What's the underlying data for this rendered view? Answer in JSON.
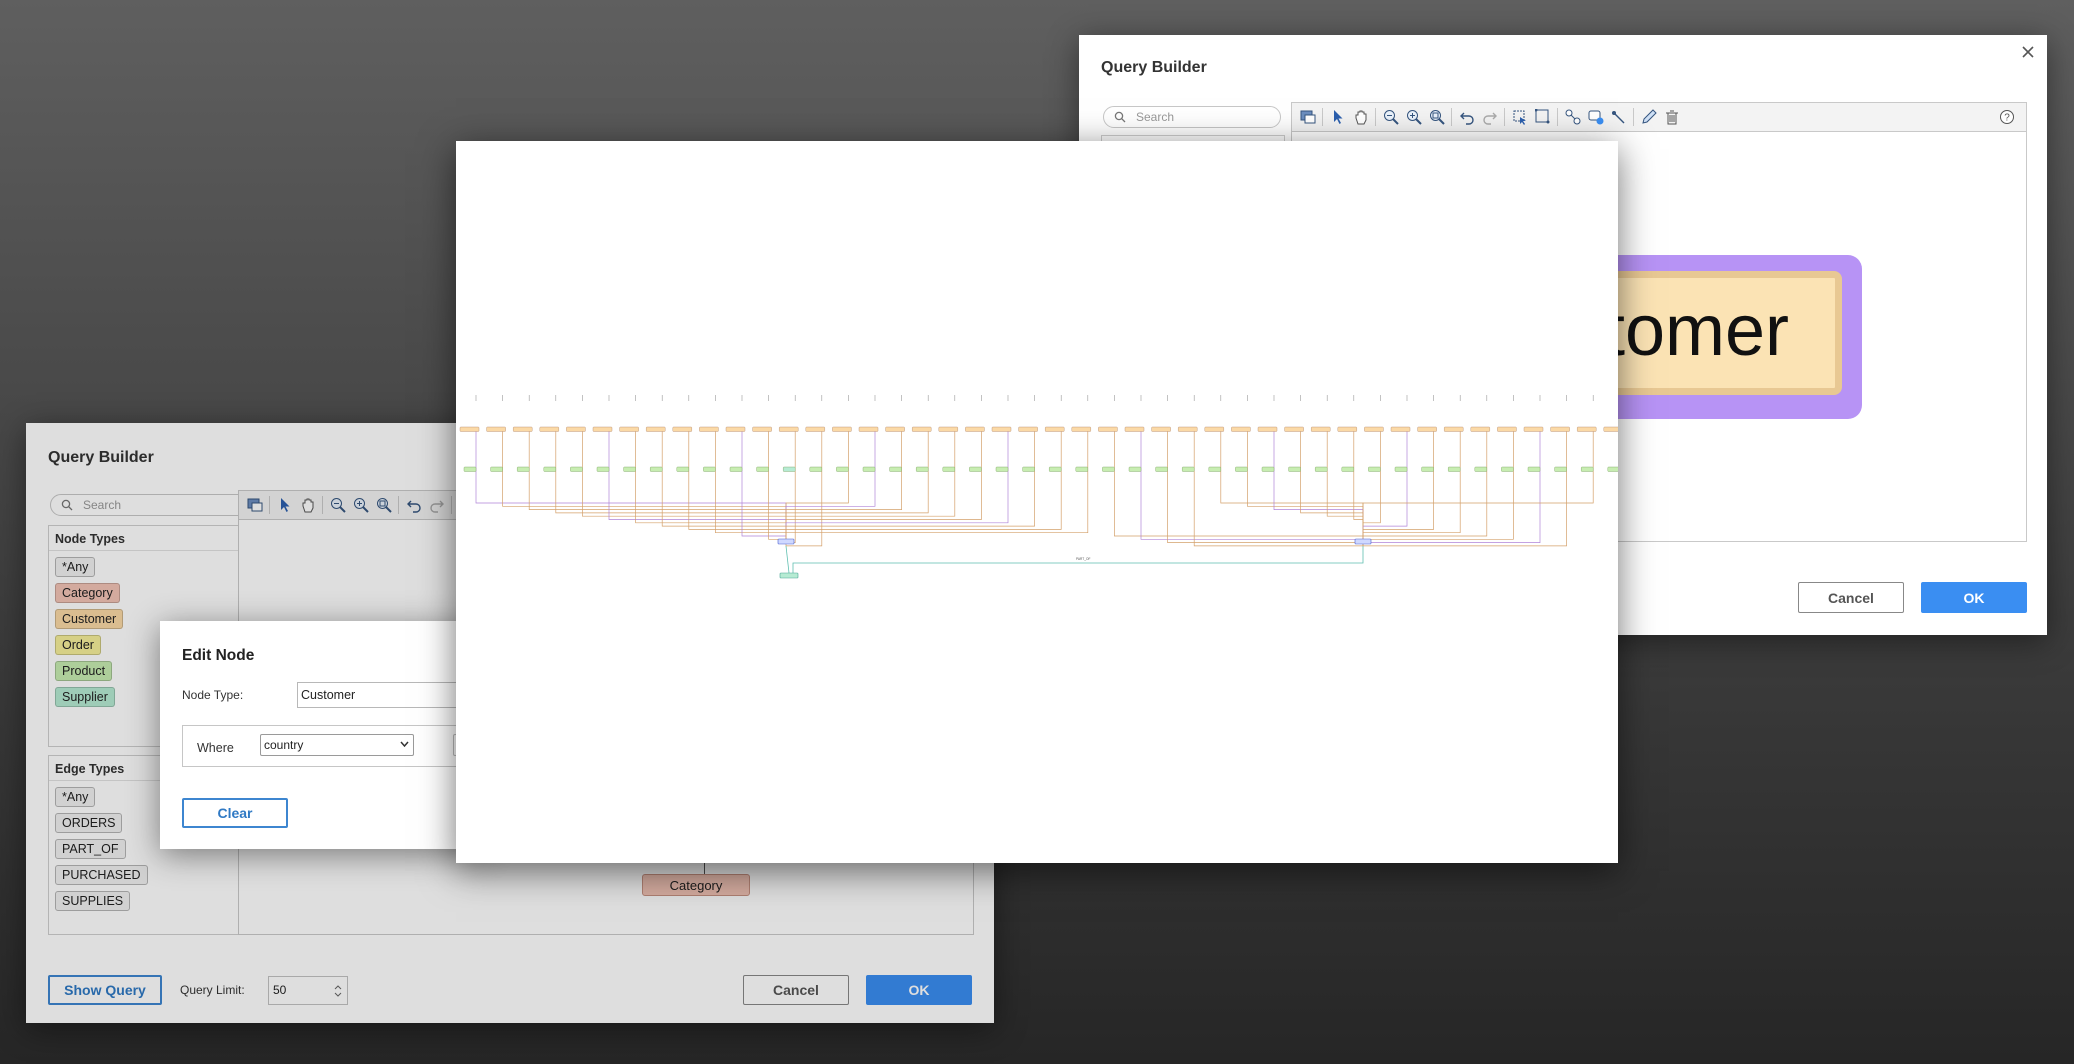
{
  "qb_back": {
    "title": "Query Builder",
    "search_placeholder": "Search",
    "node_label": "Customer",
    "cancel_label": "Cancel",
    "ok_label": "OK"
  },
  "qb_front": {
    "title": "Query Builder",
    "search_placeholder": "Search",
    "node_types_title": "Node Types",
    "node_types": [
      {
        "label": "*Any",
        "color": "#f1f1f1"
      },
      {
        "label": "Category",
        "color": "#f3c4b6"
      },
      {
        "label": "Customer",
        "color": "#fbd9a6"
      },
      {
        "label": "Order",
        "color": "#f6ef9a"
      },
      {
        "label": "Product",
        "color": "#c7edb1"
      },
      {
        "label": "Supplier",
        "color": "#b6ebd3"
      }
    ],
    "edge_types_title": "Edge Types",
    "edge_types": [
      "*Any",
      "ORDERS",
      "PART_OF",
      "PURCHASED",
      "SUPPLIES"
    ],
    "canvas_node": "Category",
    "show_query_label": "Show Query",
    "query_limit_label": "Query Limit:",
    "query_limit_value": "50",
    "cancel_label": "Cancel",
    "ok_label": "OK"
  },
  "edit_node": {
    "title": "Edit Node",
    "node_type_label": "Node Type:",
    "node_type_value": "Customer",
    "where_label": "Where",
    "where_field": "country",
    "clear_label": "Clear"
  },
  "graph": {
    "hub_nodes": [
      "Category"
    ],
    "edge_label": "PART_OF"
  },
  "colors": {
    "accent": "#3a8ef2",
    "customer": "#fbd9a6",
    "customer_selected_ring": "#b793f5",
    "category": "#f3c4b6",
    "product": "#c7edb1",
    "supplier": "#b6ebd3"
  }
}
